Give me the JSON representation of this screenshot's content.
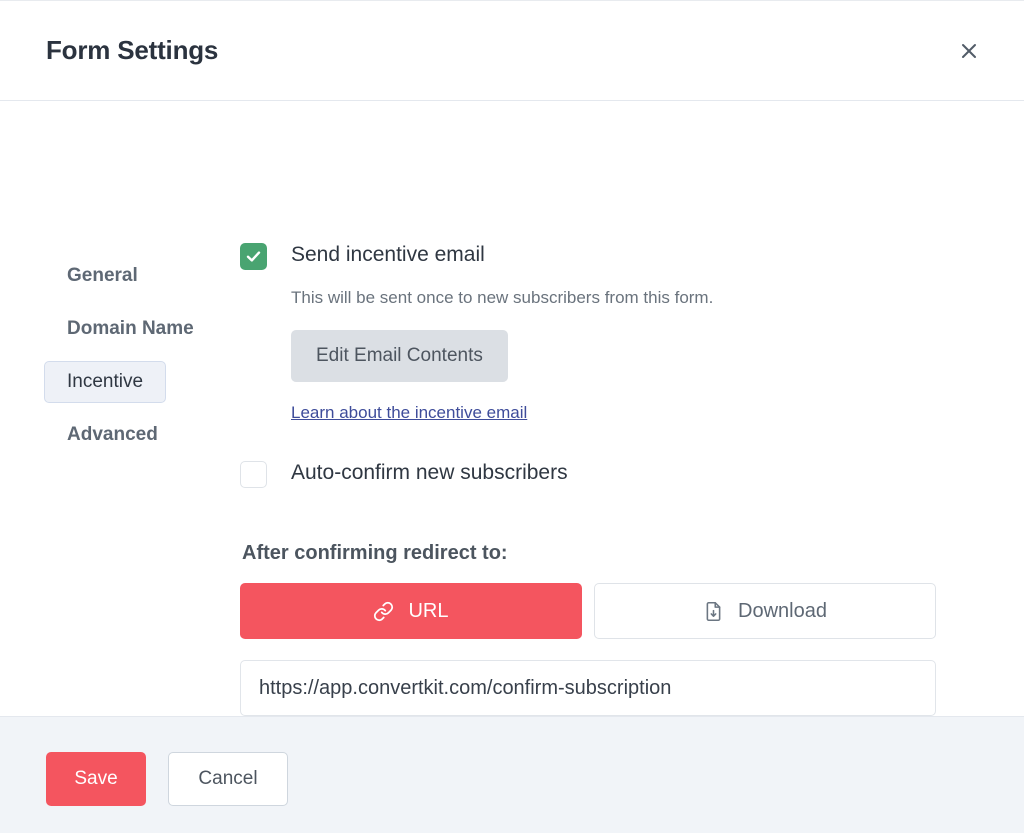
{
  "header": {
    "title": "Form Settings",
    "close_icon": "close-icon"
  },
  "sidebar": {
    "items": [
      {
        "label": "General",
        "active": false
      },
      {
        "label": "Domain Name",
        "active": false
      },
      {
        "label": "Incentive",
        "active": true
      },
      {
        "label": "Advanced",
        "active": false
      }
    ]
  },
  "main": {
    "incentive_email": {
      "checkbox_state": "checked",
      "label": "Send incentive email",
      "help_text": "This will be sent once to new subscribers from this form.",
      "edit_button_label": "Edit Email Contents",
      "learn_link_label": "Learn about the incentive email"
    },
    "auto_confirm": {
      "checkbox_state": "unchecked",
      "label": "Auto-confirm new subscribers"
    },
    "redirect": {
      "label": "After confirming redirect to:",
      "options": [
        {
          "label": "URL",
          "icon": "link-icon",
          "selected": true
        },
        {
          "label": "Download",
          "icon": "file-download-icon",
          "selected": false
        }
      ],
      "url_value": "https://app.convertkit.com/confirm-subscription",
      "url_placeholder": "https://"
    }
  },
  "footer": {
    "save_label": "Save",
    "cancel_label": "Cancel"
  },
  "colors": {
    "accent_red": "#f4555f",
    "checkbox_green": "#49a471",
    "link_blue": "#3e4c9a",
    "active_tab_bg": "#eef1f7",
    "footer_bg": "#f1f4f8"
  }
}
